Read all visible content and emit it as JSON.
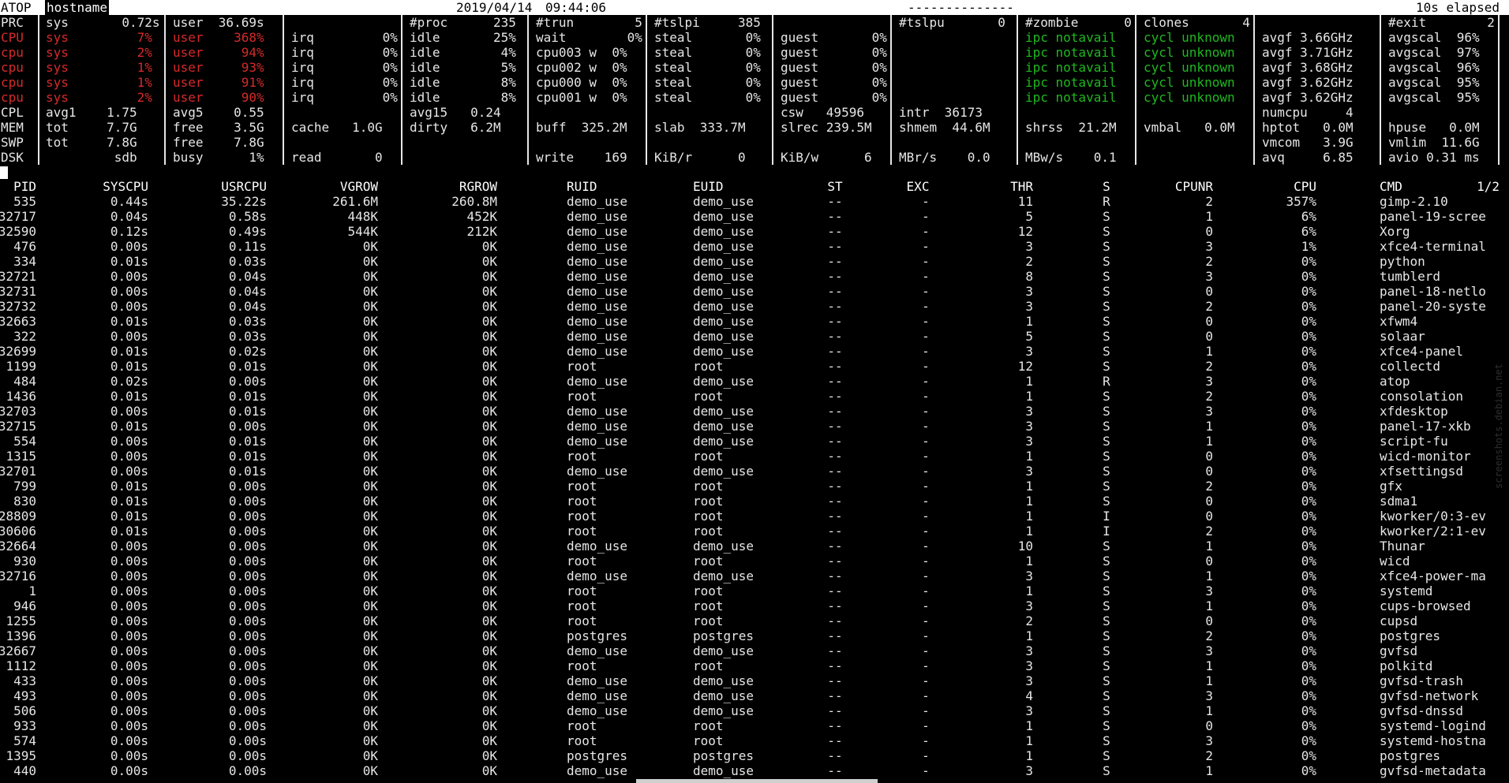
{
  "title": {
    "app": "ATOP",
    "host": "hostname",
    "date": "2019/04/14",
    "time": "09:44:06",
    "flags": "--------------",
    "elapsed": "10s elapsed"
  },
  "sys": [
    {
      "label": "PRC",
      "color": "",
      "cells": [
        "sys       0.72s",
        "user  36.69s",
        "",
        "#proc      235",
        "#trun        5",
        "#tslpi     385",
        "",
        "#tslpu       0",
        "#zombie      0",
        "clones       4",
        "",
        "#exit        2"
      ]
    },
    {
      "label": "CPU",
      "color": "red",
      "cells": [
        "sys         7%",
        "user    368%",
        "irq         0%",
        "idle       25%",
        "wait        0%",
        "steal       0%",
        "guest       0%",
        "",
        "ipc notavail",
        "cycl unknown",
        "avgf 3.66GHz",
        "avgscal  96%"
      ]
    },
    {
      "label": "cpu",
      "color": "red",
      "cells": [
        "sys         2%",
        "user     94%",
        "irq         0%",
        "idle        4%",
        "cpu003 w  0%",
        "steal       0%",
        "guest       0%",
        "",
        "ipc notavail",
        "cycl unknown",
        "avgf 3.71GHz",
        "avgscal  97%"
      ]
    },
    {
      "label": "cpu",
      "color": "red",
      "cells": [
        "sys         1%",
        "user     93%",
        "irq         0%",
        "idle        5%",
        "cpu002 w  0%",
        "steal       0%",
        "guest       0%",
        "",
        "ipc notavail",
        "cycl unknown",
        "avgf 3.68GHz",
        "avgscal  96%"
      ]
    },
    {
      "label": "cpu",
      "color": "red",
      "cells": [
        "sys         1%",
        "user     91%",
        "irq         0%",
        "idle        8%",
        "cpu000 w  0%",
        "steal       0%",
        "guest       0%",
        "",
        "ipc notavail",
        "cycl unknown",
        "avgf 3.62GHz",
        "avgscal  95%"
      ]
    },
    {
      "label": "cpu",
      "color": "red",
      "cells": [
        "sys         2%",
        "user     90%",
        "irq         0%",
        "idle        8%",
        "cpu001 w  0%",
        "steal       0%",
        "guest       0%",
        "",
        "ipc notavail",
        "cycl unknown",
        "avgf 3.62GHz",
        "avgscal  95%"
      ]
    },
    {
      "label": "CPL",
      "color": "",
      "cells": [
        "avg1    1.75",
        "avg5    0.55",
        "",
        "avg15   0.24",
        "",
        "",
        "csw   49596",
        "intr  36173",
        "",
        "",
        "numcpu     4",
        ""
      ]
    },
    {
      "label": "MEM",
      "color": "",
      "cells": [
        "tot     7.7G",
        "free    3.5G",
        "cache   1.0G",
        "dirty   6.2M",
        "buff  325.2M",
        "slab  333.7M",
        "slrec 239.5M",
        "shmem  44.6M",
        "shrss  21.2M",
        "vmbal   0.0M",
        "hptot   0.0M",
        "hpuse   0.0M"
      ]
    },
    {
      "label": "SWP",
      "color": "",
      "cells": [
        "tot     7.8G",
        "free    7.8G",
        "",
        "",
        "",
        "",
        "",
        "",
        "",
        "",
        "vmcom   3.9G",
        "vmlim  11.6G"
      ]
    },
    {
      "label": "DSK",
      "color": "",
      "cells": [
        "         sdb",
        "busy      1%",
        "read       0",
        "",
        "write    169",
        "KiB/r      0",
        "KiB/w      6",
        "MBr/s    0.0",
        "MBw/s    0.1",
        "",
        "avq     6.85",
        "avio 0.31 ms"
      ]
    }
  ],
  "proc_header": [
    "PID",
    "SYSCPU",
    "USRCPU",
    "VGROW",
    "RGROW",
    "RUID",
    "EUID",
    "ST",
    "EXC",
    "THR",
    "S",
    "CPUNR",
    "CPU",
    "CMD"
  ],
  "page_indicator": "1/2",
  "processes": [
    [
      "535",
      "0.44s",
      "35.22s",
      "261.6M",
      "260.8M",
      "demo_use",
      "demo_use",
      "--",
      "-",
      "11",
      "R",
      "2",
      "357%",
      "gimp-2.10"
    ],
    [
      "32717",
      "0.04s",
      "0.58s",
      "448K",
      "452K",
      "demo_use",
      "demo_use",
      "--",
      "-",
      "5",
      "S",
      "1",
      "6%",
      "panel-19-scree"
    ],
    [
      "32590",
      "0.12s",
      "0.49s",
      "544K",
      "212K",
      "demo_use",
      "demo_use",
      "--",
      "-",
      "12",
      "S",
      "0",
      "6%",
      "Xorg"
    ],
    [
      "476",
      "0.00s",
      "0.11s",
      "0K",
      "0K",
      "demo_use",
      "demo_use",
      "--",
      "-",
      "3",
      "S",
      "3",
      "1%",
      "xfce4-terminal"
    ],
    [
      "334",
      "0.01s",
      "0.03s",
      "0K",
      "0K",
      "demo_use",
      "demo_use",
      "--",
      "-",
      "2",
      "S",
      "2",
      "0%",
      "python"
    ],
    [
      "32721",
      "0.00s",
      "0.04s",
      "0K",
      "0K",
      "demo_use",
      "demo_use",
      "--",
      "-",
      "8",
      "S",
      "3",
      "0%",
      "tumblerd"
    ],
    [
      "32731",
      "0.00s",
      "0.04s",
      "0K",
      "0K",
      "demo_use",
      "demo_use",
      "--",
      "-",
      "3",
      "S",
      "0",
      "0%",
      "panel-18-netlo"
    ],
    [
      "32732",
      "0.00s",
      "0.04s",
      "0K",
      "0K",
      "demo_use",
      "demo_use",
      "--",
      "-",
      "3",
      "S",
      "2",
      "0%",
      "panel-20-syste"
    ],
    [
      "32663",
      "0.01s",
      "0.03s",
      "0K",
      "0K",
      "demo_use",
      "demo_use",
      "--",
      "-",
      "1",
      "S",
      "0",
      "0%",
      "xfwm4"
    ],
    [
      "322",
      "0.00s",
      "0.03s",
      "0K",
      "0K",
      "demo_use",
      "demo_use",
      "--",
      "-",
      "5",
      "S",
      "0",
      "0%",
      "solaar"
    ],
    [
      "32699",
      "0.01s",
      "0.02s",
      "0K",
      "0K",
      "demo_use",
      "demo_use",
      "--",
      "-",
      "3",
      "S",
      "1",
      "0%",
      "xfce4-panel"
    ],
    [
      "1199",
      "0.01s",
      "0.01s",
      "0K",
      "0K",
      "root",
      "root",
      "--",
      "-",
      "12",
      "S",
      "2",
      "0%",
      "collectd"
    ],
    [
      "484",
      "0.02s",
      "0.00s",
      "0K",
      "0K",
      "demo_use",
      "demo_use",
      "--",
      "-",
      "1",
      "R",
      "3",
      "0%",
      "atop"
    ],
    [
      "1436",
      "0.01s",
      "0.01s",
      "0K",
      "0K",
      "root",
      "root",
      "--",
      "-",
      "1",
      "S",
      "2",
      "0%",
      "consolation"
    ],
    [
      "32703",
      "0.00s",
      "0.01s",
      "0K",
      "0K",
      "demo_use",
      "demo_use",
      "--",
      "-",
      "3",
      "S",
      "3",
      "0%",
      "xfdesktop"
    ],
    [
      "32715",
      "0.01s",
      "0.00s",
      "0K",
      "0K",
      "demo_use",
      "demo_use",
      "--",
      "-",
      "3",
      "S",
      "1",
      "0%",
      "panel-17-xkb"
    ],
    [
      "554",
      "0.00s",
      "0.01s",
      "0K",
      "0K",
      "demo_use",
      "demo_use",
      "--",
      "-",
      "3",
      "S",
      "1",
      "0%",
      "script-fu"
    ],
    [
      "1315",
      "0.00s",
      "0.01s",
      "0K",
      "0K",
      "root",
      "root",
      "--",
      "-",
      "1",
      "S",
      "0",
      "0%",
      "wicd-monitor"
    ],
    [
      "32701",
      "0.00s",
      "0.01s",
      "0K",
      "0K",
      "demo_use",
      "demo_use",
      "--",
      "-",
      "3",
      "S",
      "0",
      "0%",
      "xfsettingsd"
    ],
    [
      "799",
      "0.01s",
      "0.00s",
      "0K",
      "0K",
      "root",
      "root",
      "--",
      "-",
      "1",
      "S",
      "2",
      "0%",
      "gfx"
    ],
    [
      "830",
      "0.01s",
      "0.00s",
      "0K",
      "0K",
      "root",
      "root",
      "--",
      "-",
      "1",
      "S",
      "0",
      "0%",
      "sdma1"
    ],
    [
      "28809",
      "0.01s",
      "0.00s",
      "0K",
      "0K",
      "root",
      "root",
      "--",
      "-",
      "1",
      "I",
      "0",
      "0%",
      "kworker/0:3-ev"
    ],
    [
      "30606",
      "0.01s",
      "0.00s",
      "0K",
      "0K",
      "root",
      "root",
      "--",
      "-",
      "1",
      "I",
      "2",
      "0%",
      "kworker/2:1-ev"
    ],
    [
      "32664",
      "0.00s",
      "0.00s",
      "0K",
      "0K",
      "demo_use",
      "demo_use",
      "--",
      "-",
      "10",
      "S",
      "1",
      "0%",
      "Thunar"
    ],
    [
      "930",
      "0.00s",
      "0.00s",
      "0K",
      "0K",
      "root",
      "root",
      "--",
      "-",
      "1",
      "S",
      "0",
      "0%",
      "wicd"
    ],
    [
      "32716",
      "0.00s",
      "0.00s",
      "0K",
      "0K",
      "demo_use",
      "demo_use",
      "--",
      "-",
      "3",
      "S",
      "1",
      "0%",
      "xfce4-power-ma"
    ],
    [
      "1",
      "0.00s",
      "0.00s",
      "0K",
      "0K",
      "root",
      "root",
      "--",
      "-",
      "1",
      "S",
      "3",
      "0%",
      "systemd"
    ],
    [
      "946",
      "0.00s",
      "0.00s",
      "0K",
      "0K",
      "root",
      "root",
      "--",
      "-",
      "3",
      "S",
      "1",
      "0%",
      "cups-browsed"
    ],
    [
      "1255",
      "0.00s",
      "0.00s",
      "0K",
      "0K",
      "root",
      "root",
      "--",
      "-",
      "2",
      "S",
      "0",
      "0%",
      "cupsd"
    ],
    [
      "1396",
      "0.00s",
      "0.00s",
      "0K",
      "0K",
      "postgres",
      "postgres",
      "--",
      "-",
      "1",
      "S",
      "2",
      "0%",
      "postgres"
    ],
    [
      "32667",
      "0.00s",
      "0.00s",
      "0K",
      "0K",
      "demo_use",
      "demo_use",
      "--",
      "-",
      "3",
      "S",
      "3",
      "0%",
      "gvfsd"
    ],
    [
      "1112",
      "0.00s",
      "0.00s",
      "0K",
      "0K",
      "root",
      "root",
      "--",
      "-",
      "3",
      "S",
      "1",
      "0%",
      "polkitd"
    ],
    [
      "433",
      "0.00s",
      "0.00s",
      "0K",
      "0K",
      "demo_use",
      "demo_use",
      "--",
      "-",
      "3",
      "S",
      "1",
      "0%",
      "gvfsd-trash"
    ],
    [
      "493",
      "0.00s",
      "0.00s",
      "0K",
      "0K",
      "demo_use",
      "demo_use",
      "--",
      "-",
      "4",
      "S",
      "3",
      "0%",
      "gvfsd-network"
    ],
    [
      "506",
      "0.00s",
      "0.00s",
      "0K",
      "0K",
      "demo_use",
      "demo_use",
      "--",
      "-",
      "3",
      "S",
      "1",
      "0%",
      "gvfsd-dnssd"
    ],
    [
      "933",
      "0.00s",
      "0.00s",
      "0K",
      "0K",
      "root",
      "root",
      "--",
      "-",
      "1",
      "S",
      "0",
      "0%",
      "systemd-logind"
    ],
    [
      "574",
      "0.00s",
      "0.00s",
      "0K",
      "0K",
      "root",
      "root",
      "--",
      "-",
      "1",
      "S",
      "3",
      "0%",
      "systemd-hostna"
    ],
    [
      "1395",
      "0.00s",
      "0.00s",
      "0K",
      "0K",
      "postgres",
      "postgres",
      "--",
      "-",
      "1",
      "S",
      "2",
      "0%",
      "postgres"
    ],
    [
      "440",
      "0.00s",
      "0.00s",
      "0K",
      "0K",
      "demo_use",
      "demo_use",
      "--",
      "-",
      "3",
      "S",
      "1",
      "0%",
      "gvfsd-metadata"
    ]
  ],
  "watermark": "screenshots.debian.net",
  "colors": {
    "red": "#d62a2a",
    "green": "#1fb81f",
    "text": "#e6e6e6",
    "bg": "#000000"
  }
}
